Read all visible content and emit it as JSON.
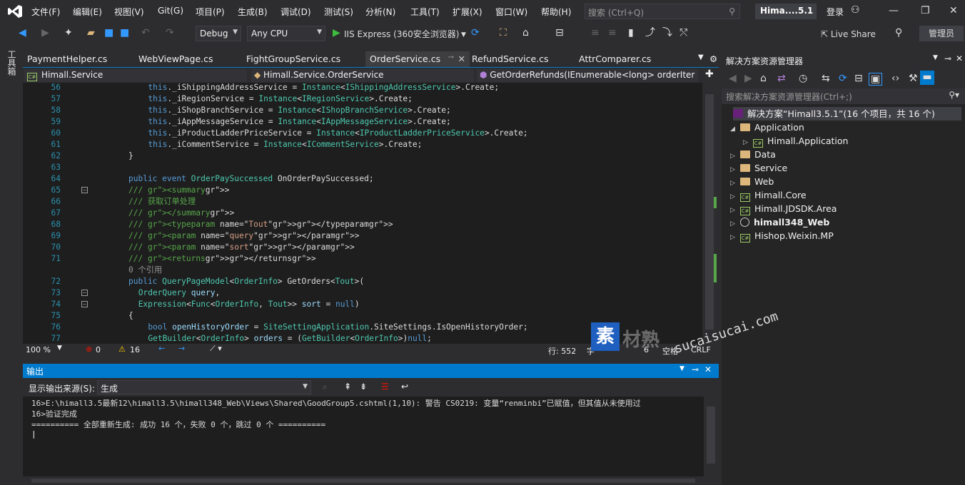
{
  "menu": [
    "文件(F)",
    "编辑(E)",
    "视图(V)",
    "Git(G)",
    "项目(P)",
    "生成(B)",
    "调试(D)",
    "测试(S)",
    "分析(N)",
    "工具(T)",
    "扩展(X)",
    "窗口(W)",
    "帮助(H)"
  ],
  "search_placeholder": "搜索 (Ctrl+Q)",
  "title_badge": "Hima....5.1",
  "login": "登录",
  "toolbar": {
    "config": "Debug",
    "platform": "Any CPU",
    "run": "IIS Express (360安全浏览器)",
    "live_share": "Live Share",
    "admin": "管理员"
  },
  "side_tab": "工具箱",
  "tabs": [
    "PaymentHelper.cs",
    "WebViewPage.cs",
    "FightGroupService.cs",
    "OrderService.cs",
    "RefundService.cs",
    "AttrComparer.cs"
  ],
  "active_tab": "OrderService.cs",
  "nav": {
    "project": "Himall.Service",
    "class": "Himall.Service.OrderService",
    "member": "GetOrderRefunds(IEnumerable<long> orderIter"
  },
  "code_lines": [
    {
      "n": "56",
      "t": "this._iShippingAddressService = Instance<IShippingAddressService>.Create;"
    },
    {
      "n": "57",
      "t": "this._iRegionService = Instance<IRegionService>.Create;"
    },
    {
      "n": "58",
      "t": "this._iShopBranchService = Instance<IShopBranchService>.Create;"
    },
    {
      "n": "59",
      "t": "this._iAppMessageService = Instance<IAppMessageService>.Create;"
    },
    {
      "n": "60",
      "t": "this._iProductLadderPriceService = Instance<IProductLadderPriceService>.Create;"
    },
    {
      "n": "61",
      "t": "this._iCommentService = Instance<ICommentService>.Create;"
    },
    {
      "n": "62",
      "t": "}"
    },
    {
      "n": "63",
      "t": ""
    },
    {
      "n": "64",
      "t": "public event OrderPaySuccessed OnOrderPaySuccessed;"
    },
    {
      "n": "65",
      "t": "/// <summary>"
    },
    {
      "n": "66",
      "t": "/// 获取订单处理"
    },
    {
      "n": "67",
      "t": "/// </summary>"
    },
    {
      "n": "68",
      "t": "/// <typeparam name=\"Tout\"></typeparam>"
    },
    {
      "n": "69",
      "t": "/// <param name=\"query\"></param>"
    },
    {
      "n": "70",
      "t": "/// <param name=\"sort\"></param>"
    },
    {
      "n": "71",
      "t": "/// <returns></returns>"
    },
    {
      "n": "",
      "t": "0 个引用"
    },
    {
      "n": "72",
      "t": "public QueryPageModel<OrderInfo> GetOrders<Tout>("
    },
    {
      "n": "73",
      "t": "OrderQuery query,"
    },
    {
      "n": "74",
      "t": "Expression<Func<OrderInfo, Tout>> sort = null)"
    },
    {
      "n": "75",
      "t": "{"
    },
    {
      "n": "76",
      "t": "bool openHistoryOrder = SiteSettingApplication.SiteSettings.IsOpenHistoryOrder;"
    },
    {
      "n": "77",
      "t": "GetBuilder<OrderInfo> orders = (GetBuilder<OrderInfo>)null;"
    }
  ],
  "editor_status": {
    "zoom": "100 %",
    "errors": "0",
    "warnings": "16",
    "line": "行: 552",
    "char": "字",
    "col": "6",
    "mode": "空格",
    "enc": "CRLF"
  },
  "output": {
    "title": "输出",
    "source_label": "显示输出来源(S):",
    "source_value": "生成",
    "lines": [
      "16>E:\\himall3.5最新12\\himall3.5\\himall348_Web\\Views\\Shared\\GoodGroup5.cshtml(1,10): 警告 CS0219: 变量“renminbi”已赋值，但其值从未使用过",
      "16>验证完成",
      "========== 全部重新生成: 成功 16 个，失败 0 个，跳过 0 个 =========="
    ]
  },
  "solution_explorer": {
    "title": "解决方案资源管理器",
    "search": "搜索解决方案资源管理器(Ctrl+;)",
    "root": "解决方案“Himall3.5.1”(16 个项目，共 16 个)",
    "items": [
      {
        "label": "Application",
        "kind": "folder",
        "level": 1,
        "expanded": true
      },
      {
        "label": "Himall.Application",
        "kind": "project",
        "level": 2
      },
      {
        "label": "Data",
        "kind": "folder",
        "level": 1
      },
      {
        "label": "Service",
        "kind": "folder",
        "level": 1
      },
      {
        "label": "Web",
        "kind": "folder",
        "level": 1
      },
      {
        "label": "Himall.Core",
        "kind": "project",
        "level": 1
      },
      {
        "label": "Himall.JDSDK.Area",
        "kind": "project",
        "level": 1
      },
      {
        "label": "himall348_Web",
        "kind": "web",
        "level": 1,
        "bold": true
      },
      {
        "label": "Hishop.Weixin.MP",
        "kind": "project",
        "level": 1
      }
    ]
  },
  "watermark": {
    "mark": "素材熟",
    "url": "sucaisucai.com"
  }
}
